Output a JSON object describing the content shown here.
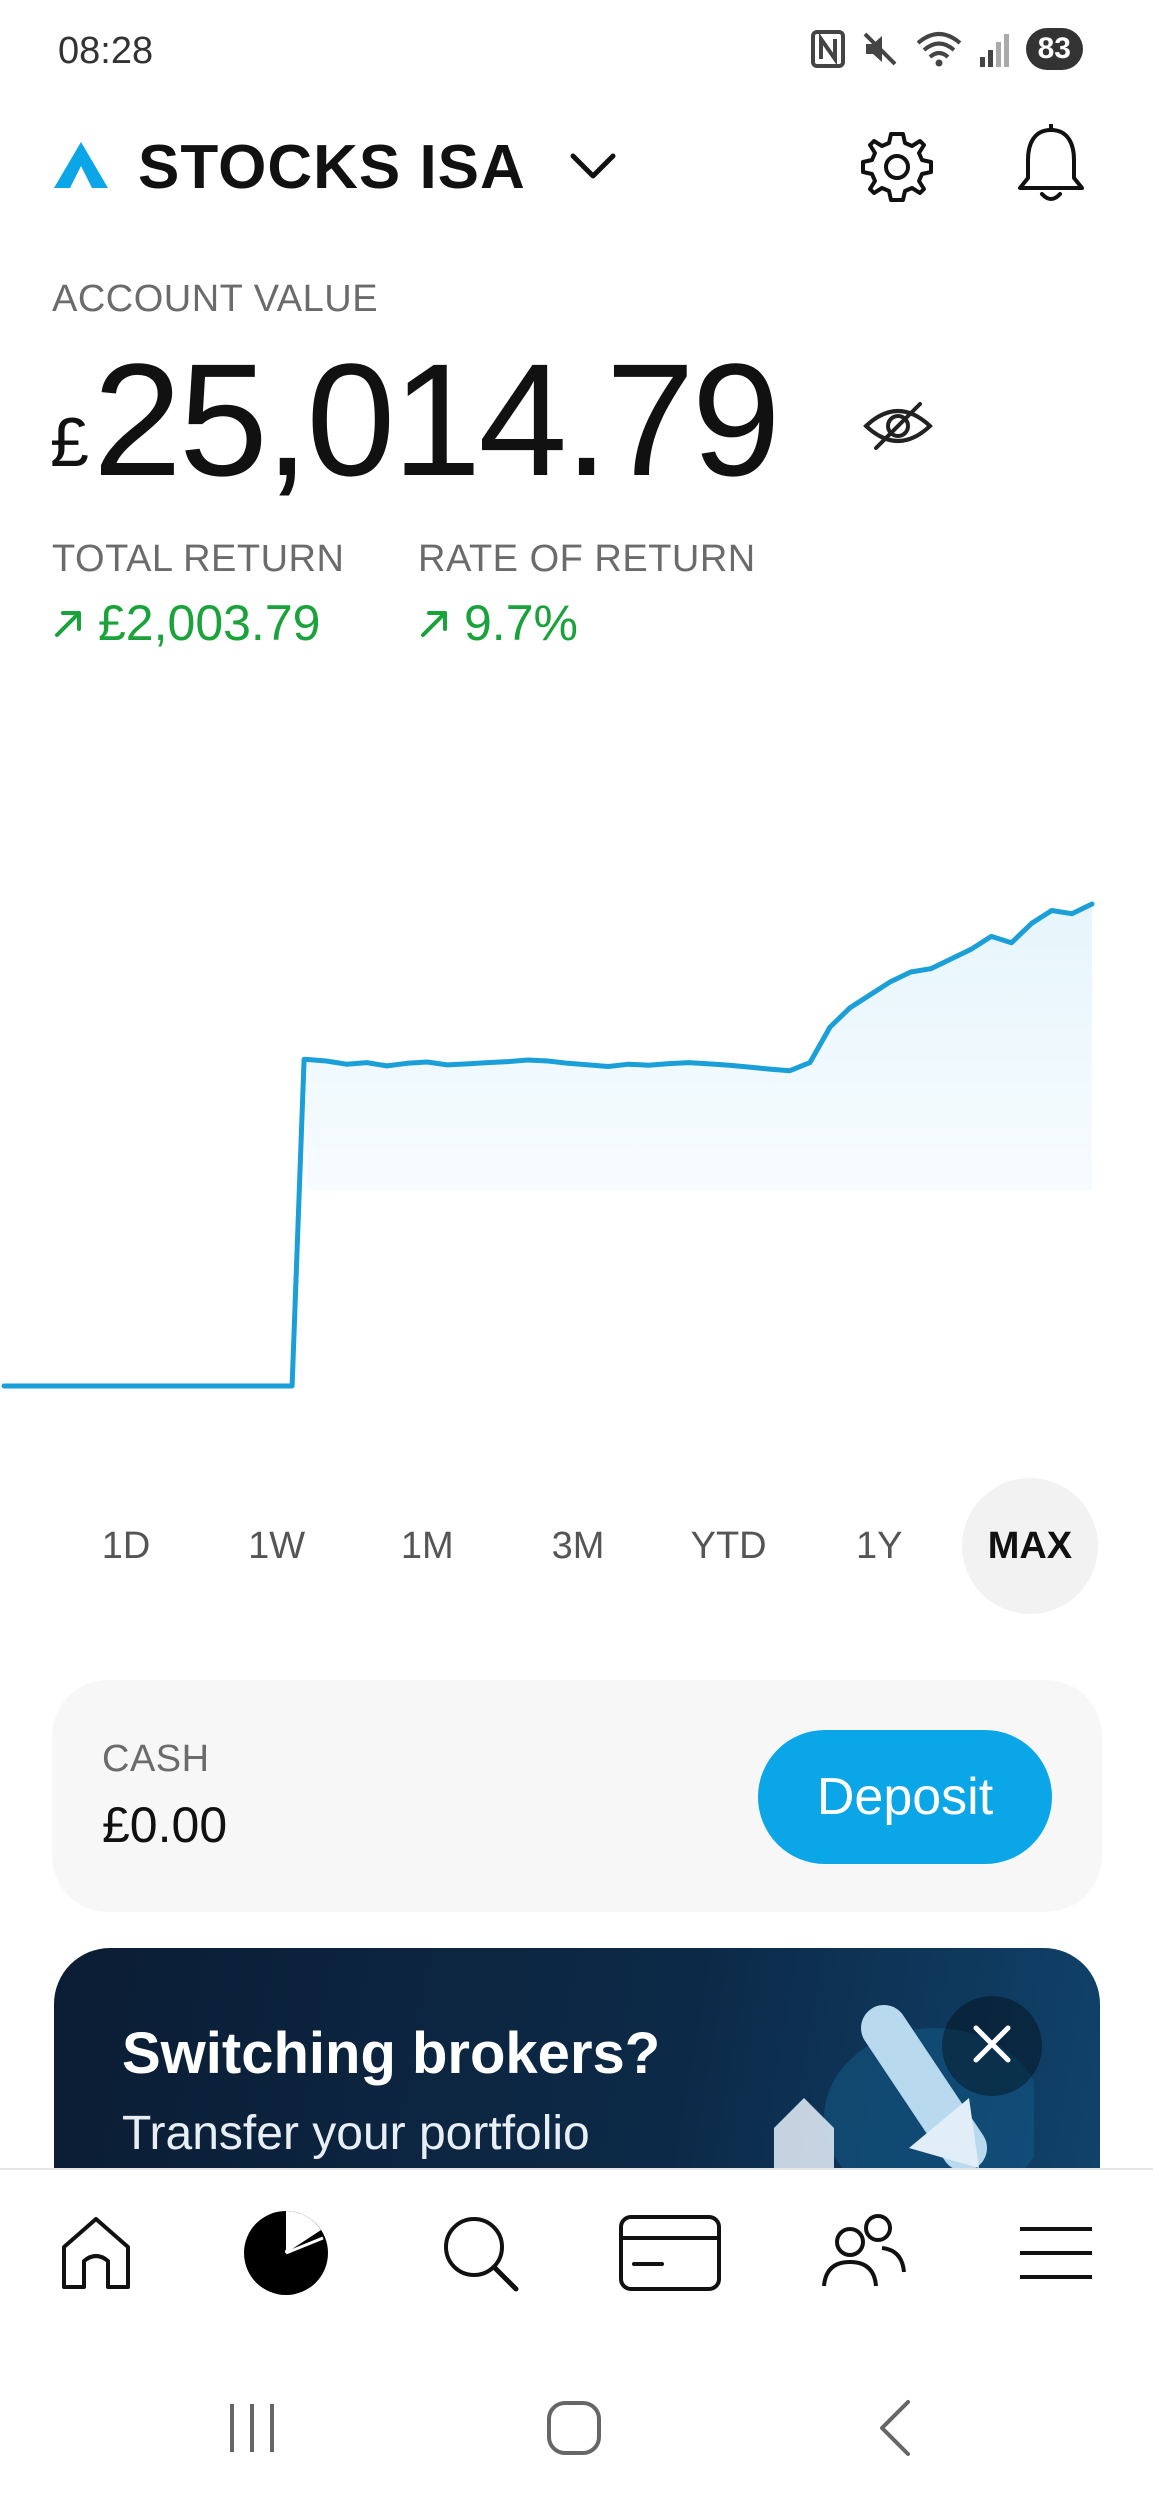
{
  "status_bar": {
    "time": "08:28",
    "battery": "83",
    "icons": [
      "nfc-icon",
      "mute-icon",
      "wifi-icon",
      "signal-icon"
    ]
  },
  "header": {
    "account_name": "STOCKS ISA",
    "brand_color": "#0aa6e8",
    "icons": [
      "brand-logo-icon",
      "chevron-down-icon",
      "gear-icon",
      "bell-icon"
    ]
  },
  "account": {
    "label": "ACCOUNT VALUE",
    "currency": "£",
    "value": "25,014.79",
    "total_return_label": "TOTAL RETURN",
    "total_return_value": "£2,003.79",
    "rate_of_return_label": "RATE OF RETURN",
    "rate_of_return_value": "9.7%",
    "positive_color": "#1aa33a"
  },
  "chart_data": {
    "type": "area",
    "line_color": "#1a9fd8",
    "fill_color": "#eef8fd",
    "values": [
      23011,
      23011,
      23011,
      23011,
      23011,
      23011,
      23011,
      23011,
      23011,
      23011,
      23011,
      23011,
      23011,
      23011,
      23011,
      24020,
      24015,
      24005,
      24010,
      24000,
      24008,
      24012,
      24003,
      24006,
      24010,
      24013,
      24018,
      24015,
      24008,
      24003,
      23998,
      24005,
      24002,
      24007,
      24010,
      24006,
      24002,
      23996,
      23990,
      23985,
      24010,
      24120,
      24180,
      24220,
      24260,
      24290,
      24300,
      24330,
      24360,
      24400,
      24380,
      24440,
      24480,
      24470,
      24500
    ],
    "xlabel": "",
    "ylabel": ""
  },
  "timeframes": {
    "items": [
      "1D",
      "1W",
      "1M",
      "3M",
      "YTD",
      "1Y",
      "MAX"
    ],
    "active": "MAX"
  },
  "cash": {
    "label": "CASH",
    "value": "£0.00",
    "button": "Deposit"
  },
  "promo": {
    "title": "Switching brokers?",
    "subtitle": "Transfer your portfolio"
  },
  "bottom_nav": {
    "items": [
      "home-icon",
      "portfolio-icon",
      "search-icon",
      "card-icon",
      "people-icon",
      "menu-icon"
    ],
    "active": "portfolio-icon"
  },
  "system_nav": [
    "recent-apps-icon",
    "home-circle-icon",
    "back-icon"
  ]
}
